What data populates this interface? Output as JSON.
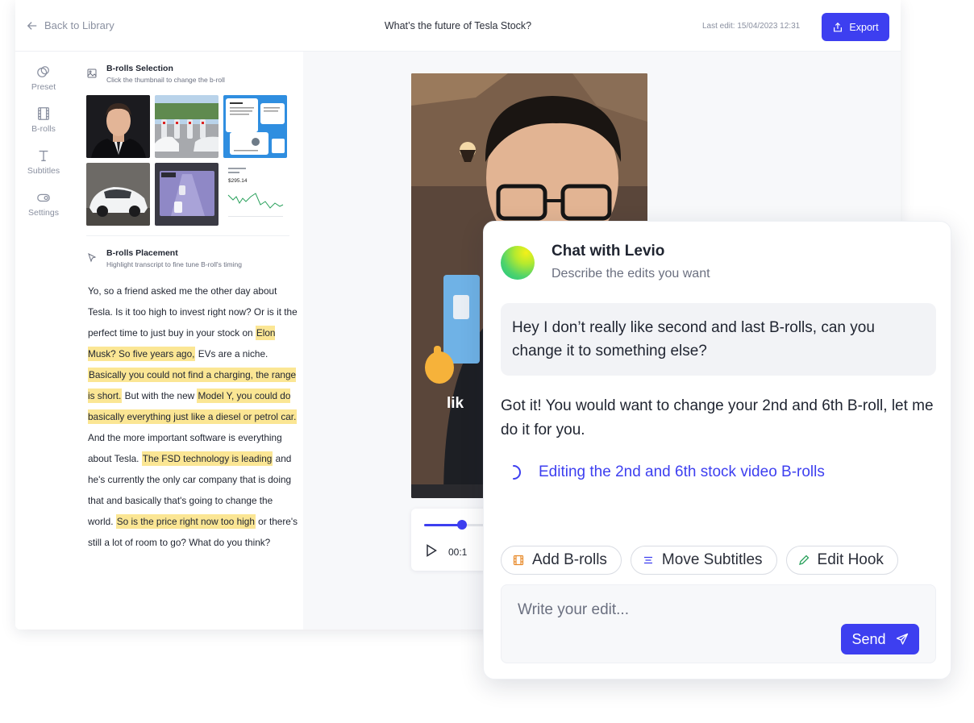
{
  "colors": {
    "accent": "#3d3ff0",
    "highlight": "#fbe694",
    "muted": "#8a90a0"
  },
  "topbar": {
    "back_label": "Back to Library",
    "title": "What’s the future of Tesla Stock?",
    "last_edit": "Last edit: 15/04/2023 12:31",
    "export_label": "Export"
  },
  "rail": [
    {
      "label": "Preset",
      "icon": "preset-icon"
    },
    {
      "label": "B-rolls",
      "icon": "film-icon"
    },
    {
      "label": "Subtitles",
      "icon": "text-icon"
    },
    {
      "label": "Settings",
      "icon": "toggle-icon"
    }
  ],
  "broll_selection": {
    "title": "B-rolls Selection",
    "subtitle": "Click the thumbnail to change the b-roll",
    "stock_price": "$295.14"
  },
  "broll_placement": {
    "title": "B-rolls Placement",
    "subtitle": "Highlight transcript to fine tune B-roll's timing"
  },
  "transcript": [
    {
      "text": "Yo, so a friend asked me the other day about Tesla. Is it too high to invest right now? Or is it the perfect time to just buy in your stock on ",
      "hl": false
    },
    {
      "text": "Elon Musk? So five years ago,",
      "hl": true
    },
    {
      "text": " EVs are a niche. ",
      "hl": false
    },
    {
      "text": "Basically you could not find a charging, the range is short.",
      "hl": true
    },
    {
      "text": " But with the new ",
      "hl": false
    },
    {
      "text": "Model Y, you could do basically everything just like a diesel or petrol car.",
      "hl": true
    },
    {
      "text": " And the more important software is everything about Tesla. ",
      "hl": false
    },
    {
      "text": "The FSD technology is leading",
      "hl": true
    },
    {
      "text": " and he's currently the only car company that is doing that and basically that's going to change the world. ",
      "hl": false
    },
    {
      "text": "So is the price right now too high",
      "hl": true
    },
    {
      "text": " or there's still a lot of room to go? What do you think?",
      "hl": false
    }
  ],
  "video": {
    "caption_partial": "lik",
    "time_partial": "00:1",
    "progress": 0.18
  },
  "chat": {
    "title": "Chat with Levio",
    "subtitle": "Describe the edits you want",
    "user_message": "Hey I don’t really like second and last B-rolls, can you change it to something else?",
    "bot_message": "Got it! You would want to change your 2nd and 6th B-roll, let me do it for you.",
    "status": "Editing the 2nd and 6th stock video B-rolls",
    "chips": [
      {
        "label": "Add B-rolls",
        "icon": "film-icon"
      },
      {
        "label": "Move Subtitles",
        "icon": "lines-icon"
      },
      {
        "label": "Edit Hook",
        "icon": "pencil-icon"
      }
    ],
    "input_placeholder": "Write your edit...",
    "send_label": "Send"
  }
}
